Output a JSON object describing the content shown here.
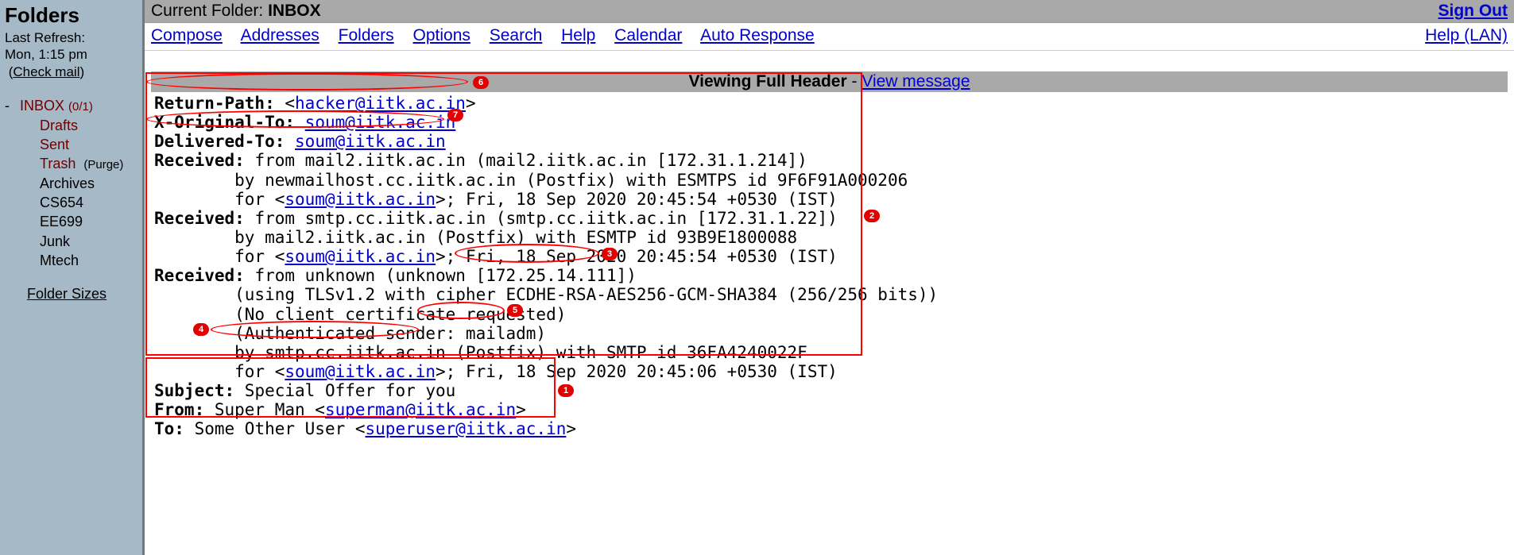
{
  "sidebar": {
    "title": "Folders",
    "refresh_label": "Last Refresh:",
    "refresh_time": "Mon, 1:15 pm",
    "check_mail": "Check mail",
    "inbox": {
      "label": "INBOX",
      "count": "(0/1)"
    },
    "items": [
      {
        "label": "Drafts",
        "color": "red"
      },
      {
        "label": "Sent",
        "color": "red"
      },
      {
        "label": "Trash",
        "color": "red",
        "purge": "(Purge)"
      },
      {
        "label": "Archives",
        "color": "black"
      },
      {
        "label": "CS654",
        "color": "black"
      },
      {
        "label": "EE699",
        "color": "black"
      },
      {
        "label": "Junk",
        "color": "black"
      },
      {
        "label": "Mtech",
        "color": "black"
      }
    ],
    "folder_sizes": "Folder Sizes"
  },
  "topbar": {
    "current_folder_label": "Current Folder: ",
    "current_folder": "INBOX",
    "signout": "Sign Out"
  },
  "menu": {
    "items": [
      "Compose",
      "Addresses",
      "Folders",
      "Options",
      "Search",
      "Help",
      "Calendar",
      "Auto Response"
    ],
    "help_lan": "Help (LAN)"
  },
  "viewbar": {
    "title": "Viewing Full Header",
    "sep": " - ",
    "view_message": "View message"
  },
  "hdr": {
    "return_path_k": "Return-Path:",
    "return_path_pre": " <",
    "return_path_link": "hacker@iitk.ac.in",
    "return_path_post": ">",
    "x_original_to_k": "X-Original-To:",
    "x_original_to_sp": " ",
    "x_original_to_link": "soum@iitk.ac.in",
    "delivered_to_k": "Delivered-To:",
    "delivered_to_sp": " ",
    "delivered_to_link": "soum@iitk.ac.in",
    "rcv1_k": "Received:",
    "rcv1_a": " from mail2.iitk.ac.in (mail2.iitk.ac.in [172.31.1.214])",
    "rcv1_b": "        by newmailhost.cc.iitk.ac.in (Postfix) with ESMTPS id 9F6F91A000206",
    "rcv1_c_pre": "        for <",
    "rcv1_c_link": "soum@iitk.ac.in",
    "rcv1_c_post": ">; Fri, 18 Sep 2020 20:45:54 +0530 (IST)",
    "rcv2_k": "Received:",
    "rcv2_a": " from smtp.cc.iitk.ac.in (smtp.cc.iitk.ac.in [172.31.1.22])",
    "rcv2_b": "        by mail2.iitk.ac.in (Postfix) with ESMTP id 93B9E1800088",
    "rcv2_c_pre": "        for <",
    "rcv2_c_link": "soum@iitk.ac.in",
    "rcv2_c_post": ">; Fri, 18 Sep 2020 20:45:54 +0530 (IST)",
    "rcv3_k": "Received:",
    "rcv3_a": " from unknown (unknown [172.25.14.111])",
    "rcv3_b": "        (using TLSv1.2 with cipher ECDHE-RSA-AES256-GCM-SHA384 (256/256 bits))",
    "rcv3_c": "        (No client certificate requested)",
    "rcv3_d": "        (Authenticated sender: mailadm)",
    "rcv3_e": "        by smtp.cc.iitk.ac.in (Postfix) with SMTP id 36FA4240022F",
    "rcv3_f_pre": "        for <",
    "rcv3_f_link": "soum@iitk.ac.in",
    "rcv3_f_post": ">; Fri, 18 Sep 2020 20:45:06 +0530 (IST)",
    "subject_k": "Subject:",
    "subject_v": " Special Offer for you",
    "from_k": "From:",
    "from_pre": " Super Man <",
    "from_link": "superman@iitk.ac.in",
    "from_post": ">",
    "to_k": "To:",
    "to_pre": " Some Other User <",
    "to_link": "superuser@iitk.ac.in",
    "to_post": ">"
  },
  "annotations": {
    "b1": "1",
    "b2": "2",
    "b3": "3",
    "b4": "4",
    "b5": "5",
    "b6": "6",
    "b7": "7"
  }
}
